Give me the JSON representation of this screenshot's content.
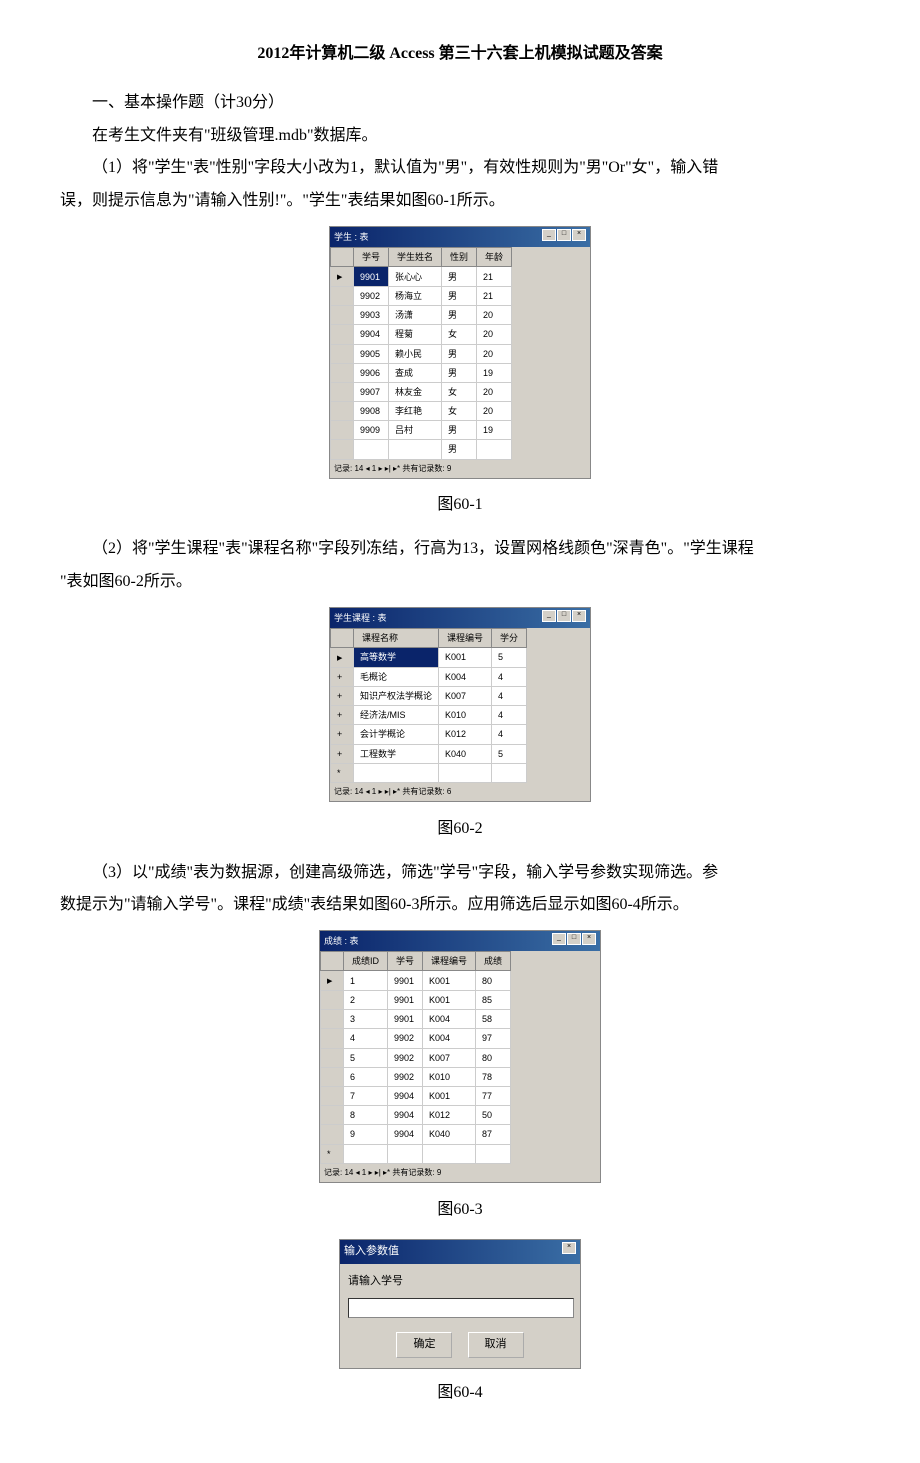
{
  "title": "2012年计算机二级 Access 第三十六套上机模拟试题及答案",
  "section1": {
    "heading": "一、基本操作题（计30分）",
    "intro": "在考生文件夹有\"班级管理.mdb\"数据库。",
    "q1_line1": "（1）将\"学生\"表\"性别\"字段大小改为1，默认值为\"男\"，有效性规则为\"男\"Or\"女\"，输入错",
    "q1_line2": "误，则提示信息为\"请输入性别!\"。\"学生\"表结果如图60-1所示。",
    "fig1_caption": "图60-1",
    "q2_line1": "（2）将\"学生课程\"表\"课程名称\"字段列冻结，行高为13，设置网格线颜色\"深青色\"。\"学生课程",
    "q2_line2": "\"表如图60-2所示。",
    "fig2_caption": "图60-2",
    "q3_line1": "（3）以\"成绩\"表为数据源，创建高级筛选，筛选\"学号\"字段，输入学号参数实现筛选。参",
    "q3_line2": "数提示为\"请输入学号\"。课程\"成绩\"表结果如图60-3所示。应用筛选后显示如图60-4所示。",
    "fig3_caption": "图60-3",
    "fig4_caption": "图60-4"
  },
  "table1": {
    "title": "学生 : 表",
    "headers": [
      "",
      "学号",
      "学生姓名",
      "性别",
      "年龄"
    ],
    "rows": [
      [
        "",
        "9901",
        "张心心",
        "男",
        "21"
      ],
      [
        "",
        "9902",
        "杨海立",
        "男",
        "21"
      ],
      [
        "",
        "9903",
        "汤潇",
        "男",
        "20"
      ],
      [
        "",
        "9904",
        "程菊",
        "女",
        "20"
      ],
      [
        "",
        "9905",
        "赖小民",
        "男",
        "20"
      ],
      [
        "",
        "9906",
        "查成",
        "男",
        "19"
      ],
      [
        "",
        "9907",
        "林友金",
        "女",
        "20"
      ],
      [
        "",
        "9908",
        "李红艳",
        "女",
        "20"
      ],
      [
        "",
        "9909",
        "吕村",
        "男",
        "19"
      ],
      [
        "",
        "",
        "",
        "男",
        ""
      ]
    ],
    "footer": "记录: 14 ◂ 1 ▸ ▸| ▸* 共有记录数: 9"
  },
  "table2": {
    "title": "学生课程 : 表",
    "headers": [
      "",
      "课程名称",
      "课程编号",
      "学分"
    ],
    "rows": [
      [
        "+",
        "高等数学",
        "K001",
        "5"
      ],
      [
        "+",
        "毛概论",
        "K004",
        "4"
      ],
      [
        "+",
        "知识产权法学概论",
        "K007",
        "4"
      ],
      [
        "+",
        "经济法/MIS",
        "K010",
        "4"
      ],
      [
        "+",
        "会计学概论",
        "K012",
        "4"
      ],
      [
        "+",
        "工程数学",
        "K040",
        "5"
      ]
    ],
    "footer": "记录: 14 ◂ 1 ▸ ▸| ▸* 共有记录数: 6"
  },
  "table3": {
    "title": "成绩 : 表",
    "headers": [
      "",
      "成绩ID",
      "学号",
      "课程编号",
      "成绩"
    ],
    "rows": [
      [
        "",
        "1",
        "9901",
        "K001",
        "80"
      ],
      [
        "",
        "2",
        "9901",
        "K001",
        "85"
      ],
      [
        "",
        "3",
        "9901",
        "K004",
        "58"
      ],
      [
        "",
        "4",
        "9902",
        "K004",
        "97"
      ],
      [
        "",
        "5",
        "9902",
        "K007",
        "80"
      ],
      [
        "",
        "6",
        "9902",
        "K010",
        "78"
      ],
      [
        "",
        "7",
        "9904",
        "K001",
        "77"
      ],
      [
        "",
        "8",
        "9904",
        "K012",
        "50"
      ],
      [
        "",
        "9",
        "9904",
        "K040",
        "87"
      ]
    ],
    "footer": "记录: 14 ◂ 1 ▸ ▸| ▸* 共有记录数: 9"
  },
  "dialog": {
    "title": "输入参数值",
    "label": "请输入学号",
    "ok": "确定",
    "cancel": "取消"
  }
}
